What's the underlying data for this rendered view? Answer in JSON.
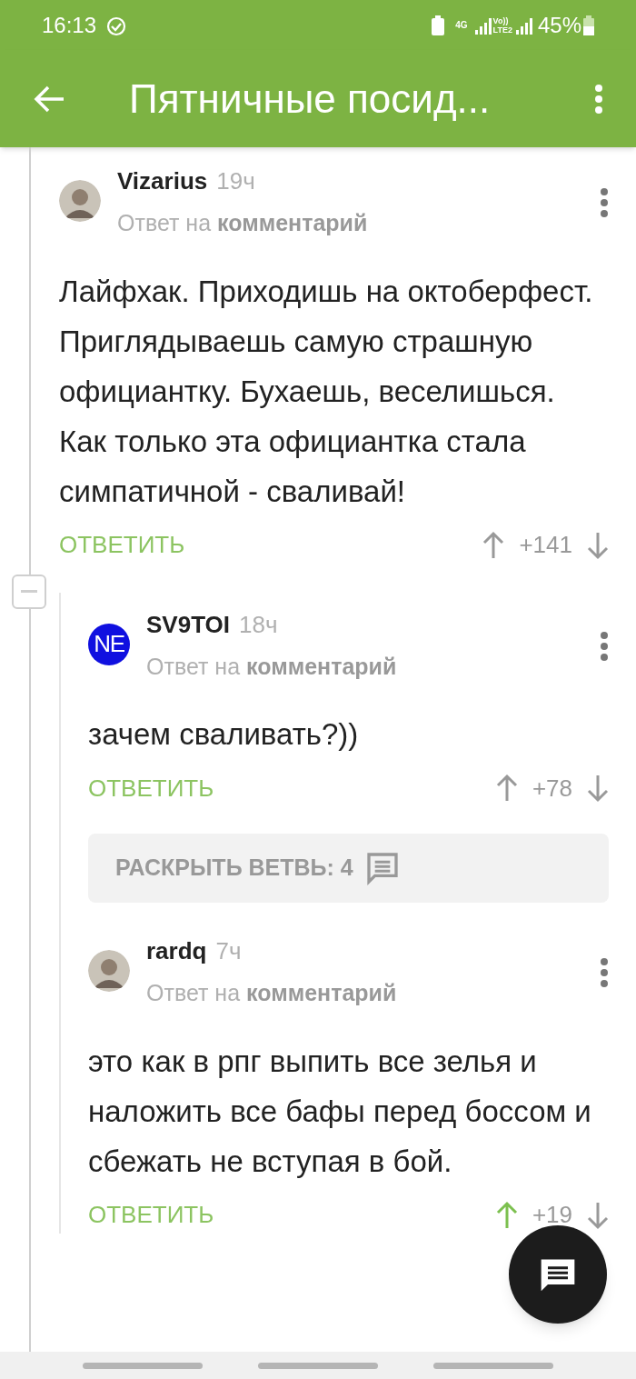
{
  "status_bar": {
    "time": "16:13",
    "network": "4G",
    "volte": "Vo))",
    "lte": "LTE2",
    "battery": "45%"
  },
  "app_bar": {
    "title": "Пятничные посид..."
  },
  "comments": [
    {
      "author": "Vizarius",
      "time": "19ч",
      "reply_to": "Ответ на **комментарий**",
      "text": "Лайфхак. Приходишь на октоберфест. Приглядываешь самую страшную официантку. Бухаешь, веселишься. Как только эта официантка стала симпатичной - сваливай!",
      "reply_label": "ОТВЕТИТЬ",
      "rating": "+141",
      "upvoted": false,
      "expanded": true,
      "children": [
        {
          "author": "SV9TOI",
          "time": "18ч",
          "avatar": {
            "kind": "text",
            "text": "NE"
          },
          "reply_to": "Ответ на **комментарий**",
          "text": "зачем сваливать?))",
          "reply_label": "ОТВЕТИТЬ",
          "rating": "+78",
          "upvoted": false,
          "expand_branch": "РАСКРЫТЬ ВЕТВЬ: 4"
        },
        {
          "author": "rardq",
          "time": "7ч",
          "reply_to": "Ответ на **комментарий**",
          "text": "это как в рпг выпить все зелья и наложить все бафы перед боссом и сбежать не вступая в бой.",
          "reply_label": "ОТВЕТИТЬ",
          "rating": "+19",
          "upvoted": true
        }
      ]
    }
  ]
}
